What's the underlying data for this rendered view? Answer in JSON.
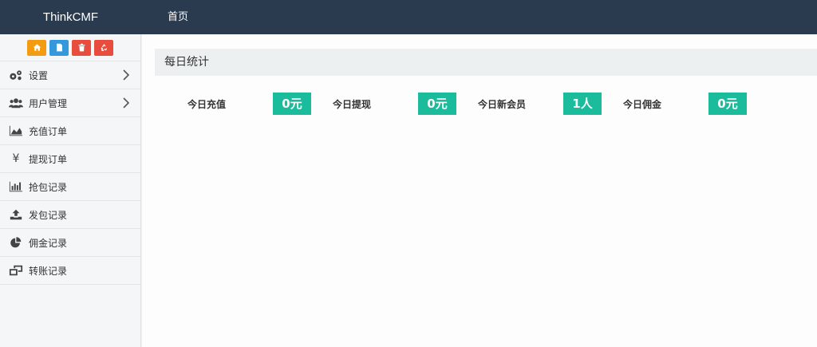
{
  "app": {
    "brand": "ThinkCMF"
  },
  "topnav": {
    "home_label": "首页"
  },
  "shortcuts": [
    {
      "icon": "home-icon",
      "color": "#f39c12"
    },
    {
      "icon": "file-icon",
      "color": "#3498db"
    },
    {
      "icon": "trash-icon",
      "color": "#e74c3c"
    },
    {
      "icon": "recycle-icon",
      "color": "#e74c3c"
    }
  ],
  "sidebar": {
    "items": [
      {
        "label": "设置",
        "icon": "gears-icon",
        "has_children": true
      },
      {
        "label": "用户管理",
        "icon": "users-icon",
        "has_children": true
      },
      {
        "label": "充值订单",
        "icon": "area-chart-icon",
        "has_children": false
      },
      {
        "label": "提现订单",
        "icon": "yen-icon",
        "has_children": false
      },
      {
        "label": "抢包记录",
        "icon": "bar-chart-icon",
        "has_children": false
      },
      {
        "label": "发包记录",
        "icon": "upload-icon",
        "has_children": false
      },
      {
        "label": "佣金记录",
        "icon": "pie-chart-icon",
        "has_children": false
      },
      {
        "label": "转账记录",
        "icon": "clone-icon",
        "has_children": false
      }
    ]
  },
  "main": {
    "title": "每日统计",
    "stats": [
      {
        "label": "今日充值",
        "value": "0元"
      },
      {
        "label": "今日提现",
        "value": "0元"
      },
      {
        "label": "今日新会员",
        "value": "1人"
      },
      {
        "label": "今日佣金",
        "value": "0元"
      }
    ]
  },
  "colors": {
    "topbar": "#2b3b4f",
    "accent": "#1abc9c",
    "panel_header": "#ecf0f1"
  }
}
